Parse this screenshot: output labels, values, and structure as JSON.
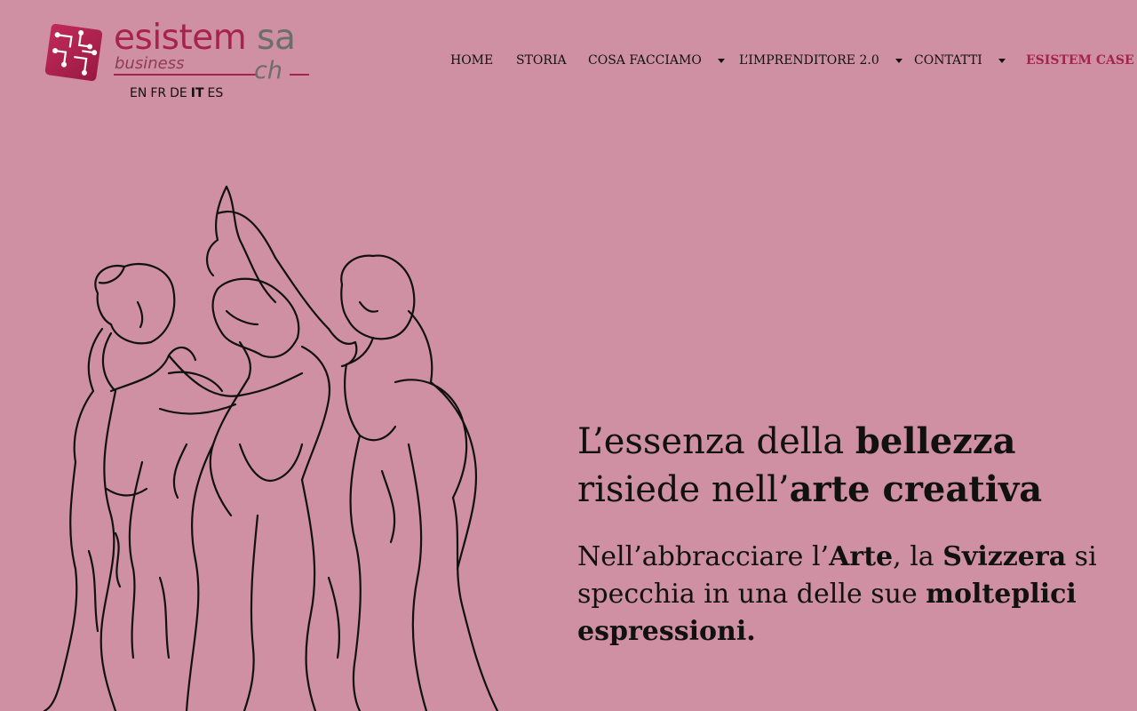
{
  "brand": {
    "name": "esistem",
    "suffix": "sa",
    "tagline": "business",
    "country": "ch",
    "colors": {
      "primary": "#a8224f",
      "secondary": "#6d6d6d",
      "background": "#cf90a4"
    }
  },
  "languages": [
    {
      "code": "EN",
      "active": false
    },
    {
      "code": "FR",
      "active": false
    },
    {
      "code": "DE",
      "active": false
    },
    {
      "code": "IT",
      "active": true
    },
    {
      "code": "ES",
      "active": false
    }
  ],
  "nav": [
    {
      "label": "HOME",
      "dropdown": false
    },
    {
      "label": "STORIA",
      "dropdown": false
    },
    {
      "label": "COSA FACCIAMO",
      "dropdown": true
    },
    {
      "label": "L’IMPRENDITORE 2.0",
      "dropdown": true
    },
    {
      "label": "CONTATTI",
      "dropdown": true
    },
    {
      "label": "ESISTEM CASE",
      "dropdown": false,
      "highlight": true
    }
  ],
  "hero": {
    "title_line1_normal": "L’essenza della ",
    "title_line1_bold": "bellezza",
    "title_line2_normal": "risiede nell’",
    "title_line2_bold": "arte creativa",
    "sub_part1": "Nell’abbracciare l’",
    "sub_bold1": "Arte",
    "sub_part2": ", la ",
    "sub_bold2": "Svizzera",
    "sub_part3": " si specchia in una delle sue ",
    "sub_bold3": "molteplici espressioni."
  },
  "illustration": {
    "subject": "three-graces-line-drawing",
    "stroke_color": "#111111"
  }
}
